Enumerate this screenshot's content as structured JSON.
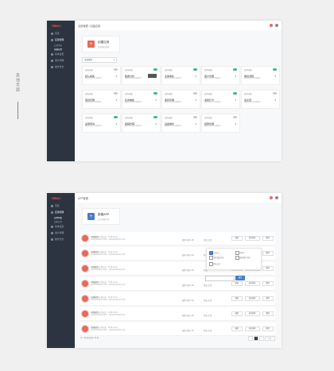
{
  "caption": "其他页面",
  "brand": "FIRMLY",
  "nav": {
    "home": "首页",
    "apps": "应用管理",
    "app_list": "应用列表",
    "app_create": "创建应用",
    "settings": "基本设置",
    "users": "用户管理",
    "logs": "操作日志"
  },
  "page1": {
    "breadcrumb": "应用管理 / 创建应用",
    "hero_title": "创建应用",
    "hero_sub": "选择模板创建",
    "select_value": "全部类型",
    "cards": [
      {
        "label": "应用功能",
        "title": "默认模板",
        "desc": "模板说明文字内容展示"
      },
      {
        "label": "应用功能",
        "title": "数据分析",
        "desc": "模板说明文字内容展示"
      },
      {
        "label": "应用功能",
        "title": "表单收集",
        "desc": "模板说明文字内容展示"
      },
      {
        "label": "应用功能",
        "title": "客户管理",
        "desc": "模板说明文字内容展示"
      },
      {
        "label": "应用功能",
        "title": "审批流程",
        "desc": "模板说明文字内容展示"
      },
      {
        "label": "应用功能",
        "title": "项目管理",
        "desc": "模板说明文字内容展示"
      },
      {
        "label": "应用功能",
        "title": "任务看板",
        "desc": "模板说明文字内容展示"
      },
      {
        "label": "应用功能",
        "title": "库存管理",
        "desc": "模板说明文字内容展示"
      },
      {
        "label": "应用功能",
        "title": "考勤打卡",
        "desc": "模板说明文字内容展示"
      },
      {
        "label": "应用功能",
        "title": "会议室",
        "desc": "模板说明文字内容展示"
      },
      {
        "label": "应用功能",
        "title": "采购申请",
        "desc": "模板说明文字内容展示"
      },
      {
        "label": "应用功能",
        "title": "报销管理",
        "desc": "模板说明文字内容展示"
      },
      {
        "label": "应用功能",
        "title": "设备维护",
        "desc": "模板说明文字内容展示"
      },
      {
        "label": "应用功能",
        "title": "招聘管理",
        "desc": "模板说明文字内容展示"
      }
    ],
    "toggles_on": [
      false,
      true,
      true,
      true,
      true,
      false,
      true,
      false,
      true,
      false,
      true,
      true,
      false,
      false
    ]
  },
  "page2": {
    "breadcrumb": "APP管理",
    "hero_title": "新建APP",
    "hero_sub": "点击创建应用",
    "rows": [
      {
        "name": "示例应用",
        "tag": "应用标签 · 2018-01-01",
        "desc": "应用说明内容文字展示，这里是应用的简介信息",
        "stat": "使用人数 1.2k",
        "state": "状态  正常",
        "b1": "编辑",
        "b2": "发布版本",
        "b3": "删除"
      },
      {
        "name": "示例应用",
        "tag": "应用标签 · 2018-01-01",
        "desc": "应用说明内容文字展示，这里是应用的简介信息",
        "stat": "使用人数 1.2k",
        "state": "状态",
        "b1": "编辑",
        "b2": "发布版本",
        "b3": "删除"
      },
      {
        "name": "示例应用",
        "tag": "应用标签 · 2018-01-01",
        "desc": "应用说明内容文字展示，这里是应用的简介信息",
        "stat": "使用人数 1.2k",
        "state": "状态",
        "b1": "编辑",
        "b2": "发布版本",
        "b3": "删除"
      },
      {
        "name": "示例应用",
        "tag": "应用标签 · 2018-01-01",
        "desc": "应用说明内容文字展示，这里是应用的简介信息",
        "stat": "使用人数 1.2k",
        "state": "状态  正常",
        "b1": "编辑",
        "b2": "发布版本",
        "b3": "删除"
      },
      {
        "name": "示例应用",
        "tag": "应用标签 · 2018-01-01",
        "desc": "应用说明内容文字展示，这里是应用的简介信息",
        "stat": "使用人数 1.2k",
        "state": "状态  正常",
        "b1": "编辑",
        "b2": "发布版本",
        "b3": "删除"
      },
      {
        "name": "示例应用",
        "tag": "应用标签 · 2018-01-01",
        "desc": "应用说明内容文字展示，这里是应用的简介信息",
        "stat": "使用人数 1.2k",
        "state": "状态  正常",
        "b1": "编辑",
        "b2": "发布版本",
        "b3": "删除"
      },
      {
        "name": "示例应用",
        "tag": "应用标签 · 2018-01-01",
        "desc": "应用说明内容文字展示，这里是应用的简介信息",
        "stat": "使用人数 1.2k",
        "state": "状态  正常",
        "b1": "编辑",
        "b2": "发布版本",
        "b3": "删除"
      }
    ],
    "popover": {
      "o1": "仅自己",
      "o2": "所有人",
      "o3": "指定成员可见",
      "o4": "指定部门可见",
      "o5": "默认公开"
    },
    "edit_btn": "确定",
    "footer": "共 7 条   每页显示 10 条",
    "pages": [
      "‹",
      "1",
      "2",
      "3",
      "›"
    ]
  },
  "colors": {
    "sidebar": "#2b3440",
    "accent_red": "#e56a5e",
    "accent_blue": "#4a7bc8",
    "toggle_on": "#41b883"
  }
}
